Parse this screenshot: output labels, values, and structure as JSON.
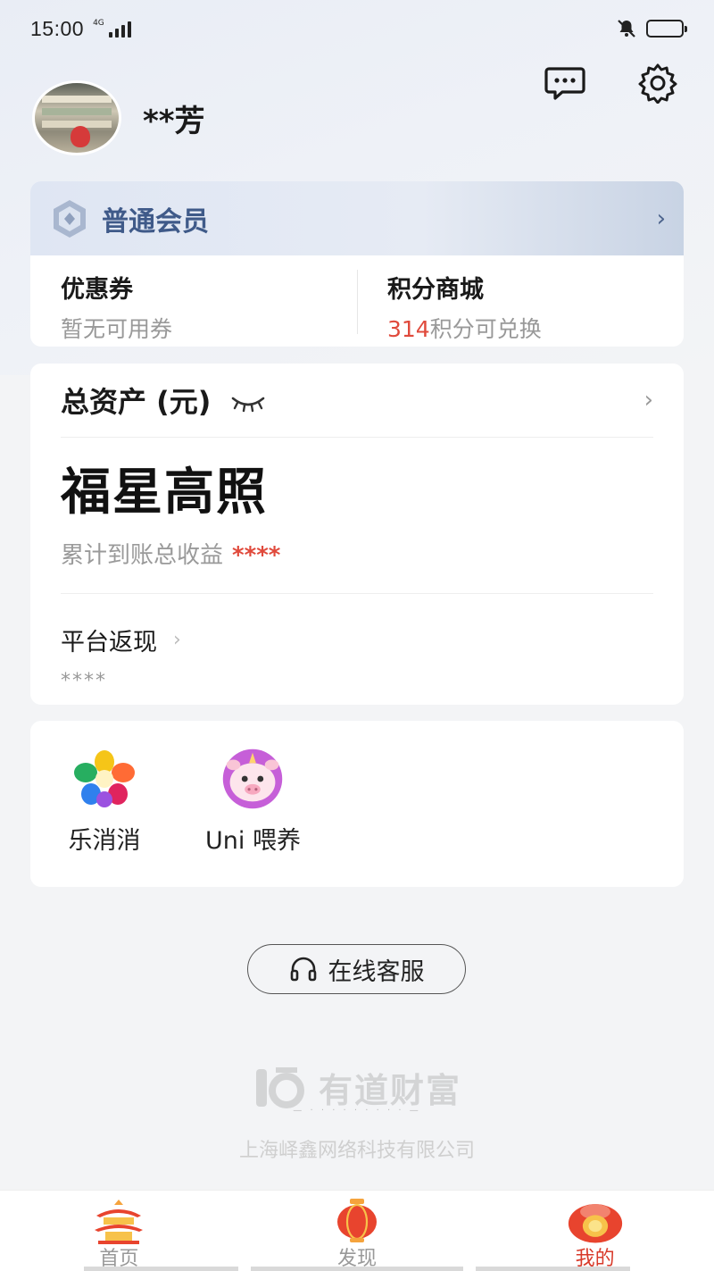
{
  "status_bar": {
    "time": "15:00",
    "network": "4G"
  },
  "profile": {
    "username": "**芳"
  },
  "member": {
    "level": "普通会员",
    "coupon_label": "优惠券",
    "coupon_status": "暂无可用券",
    "points_label": "积分商城",
    "points_value": "314",
    "points_suffix": "积分可兑换"
  },
  "assets": {
    "title": "总资产 (元)",
    "amount": "福星高照",
    "earnings_label": "累计到账总收益",
    "earnings_value": "****",
    "cashback_label": "平台返现",
    "cashback_value": "****"
  },
  "games": [
    {
      "label": "乐消消",
      "icon": "flower-icon"
    },
    {
      "label": "Uni 喂养",
      "icon": "unicorn-pig-icon"
    }
  ],
  "service": {
    "label": "在线客服"
  },
  "footer": {
    "brand": "有道财富",
    "company": "上海峄鑫网络科技有限公司"
  },
  "tabs": [
    {
      "label": "首页",
      "icon": "pavilion-icon",
      "active": false
    },
    {
      "label": "发现",
      "icon": "lantern-icon",
      "active": false
    },
    {
      "label": "我的",
      "icon": "lucky-bag-icon",
      "active": true
    }
  ],
  "colors": {
    "accent_red": "#e04a3c",
    "member_blue": "#3f5a89",
    "battery": "#f5d000"
  }
}
